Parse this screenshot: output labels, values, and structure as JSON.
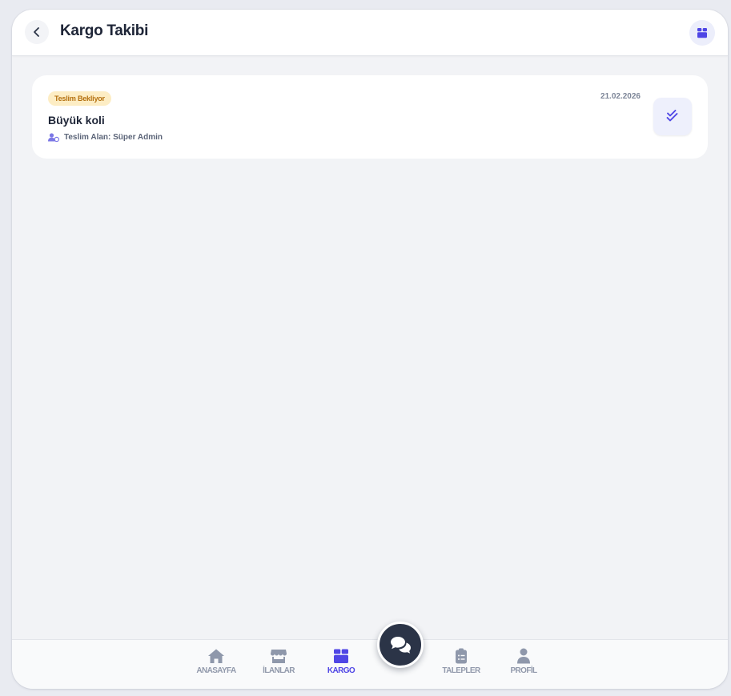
{
  "header": {
    "title": "Kargo Takibi",
    "back_icon": "chevron-left-icon",
    "right_icon": "package-icon"
  },
  "shipments": [
    {
      "status": "Teslim Bekliyor",
      "date": "21.02.2026",
      "title": "Büyük koli",
      "receiver": "Teslim Alan: Süper Admin",
      "action_icon": "double-check-icon"
    }
  ],
  "nav": {
    "items": [
      {
        "label": "ANASAYFA",
        "icon": "home-icon"
      },
      {
        "label": "İLANLAR",
        "icon": "store-icon"
      },
      {
        "label": "KARGO",
        "icon": "package-icon",
        "active": true
      },
      {
        "label": "TALEPLER",
        "icon": "clipboard-list-icon"
      },
      {
        "label": "PROFİL",
        "icon": "user-icon"
      }
    ],
    "center_icon": "chat-bubbles-icon"
  },
  "colors": {
    "accent": "#4f46e5",
    "badge_bg": "#fdedc4",
    "badge_text": "#b4700f",
    "nav_inactive": "#9199ab",
    "fab_bg": "#2b3447",
    "background": "#f2f3f6"
  }
}
